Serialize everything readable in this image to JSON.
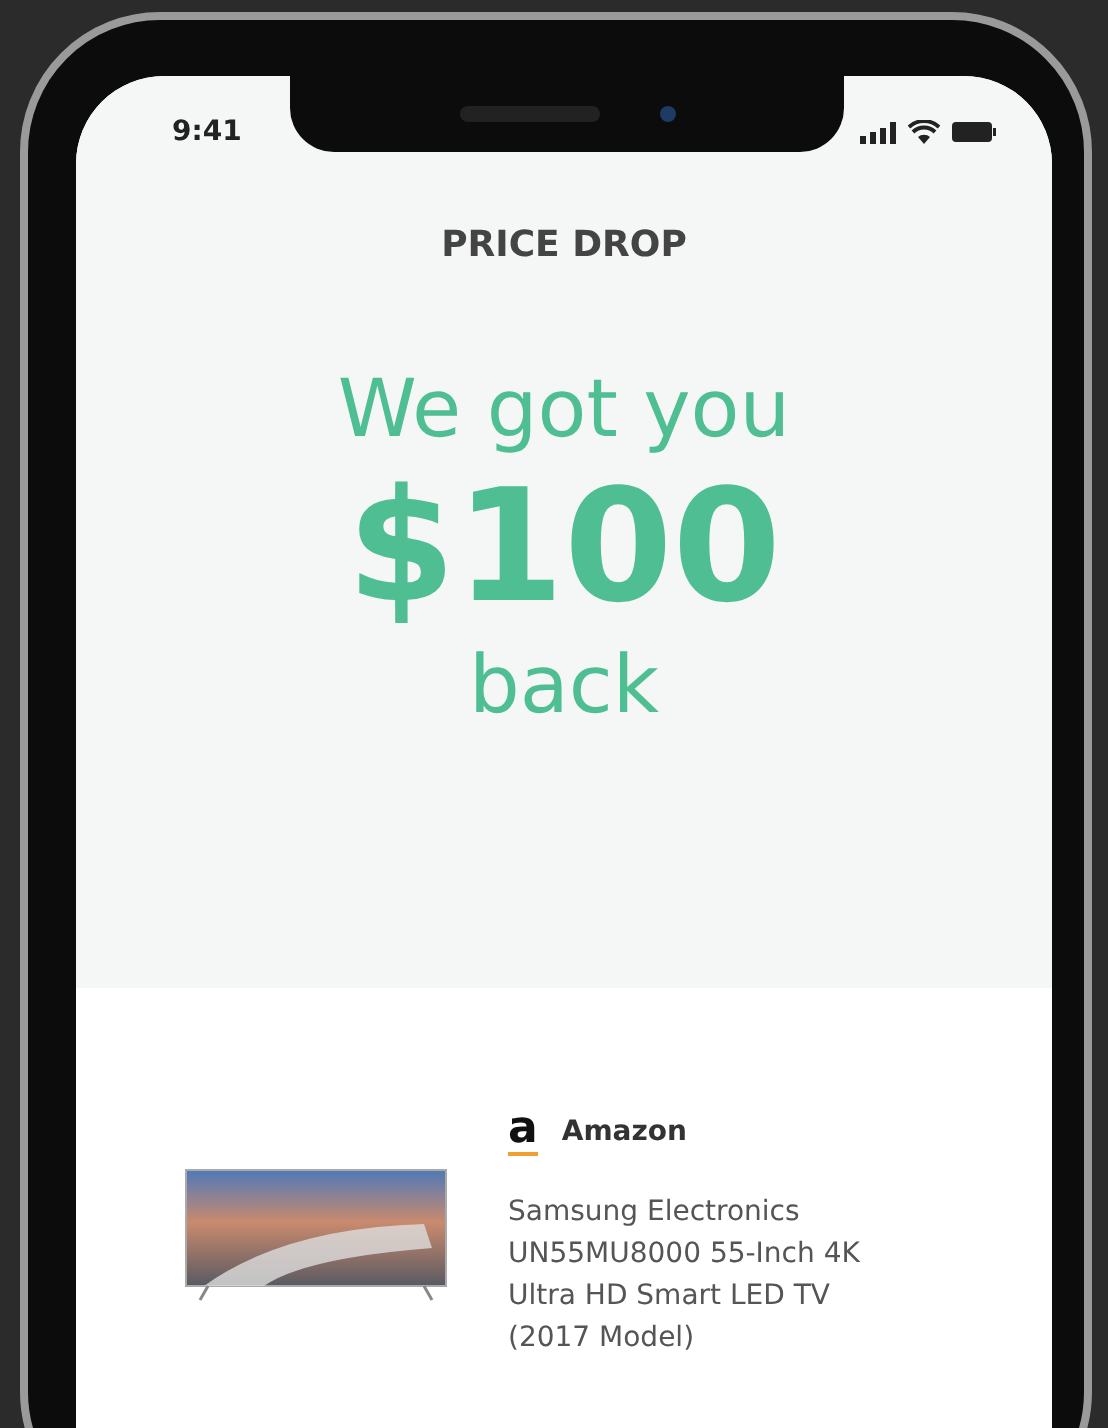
{
  "status_bar": {
    "time": "9:41"
  },
  "header": {
    "title": "PRICE DROP"
  },
  "hero": {
    "line_1": "We got you",
    "amount": "$100",
    "line_2": "back"
  },
  "product": {
    "store_logo": "a",
    "store": "Amazon",
    "title": "Samsung Electronics UN55MU8000 55-Inch 4K Ultra HD Smart LED TV (2017 Model)"
  }
}
